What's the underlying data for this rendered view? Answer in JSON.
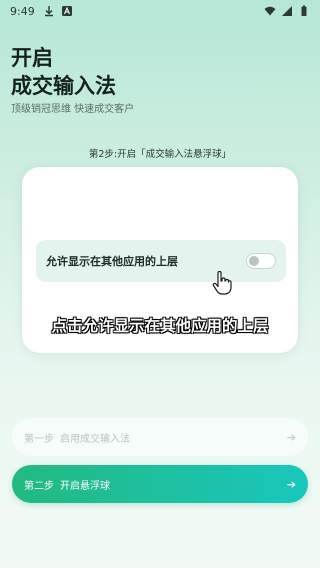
{
  "status_bar": {
    "time": "9:49",
    "icons": [
      "download-icon",
      "a-icon",
      "wifi-icon",
      "signal-icon",
      "battery-icon"
    ]
  },
  "header": {
    "title_line1": "开启",
    "title_line2": "成交输入法",
    "subtitle": "顶级销冠思维 快速成交客户"
  },
  "step_caption": "第2步:开启「成交输入法悬浮球」",
  "demo": {
    "toggle_label": "允许显示在其他应用的上层",
    "toggle_on": false,
    "overlay_text": "点击允许显示在其他应用的上层"
  },
  "steps": [
    {
      "step": "第一步",
      "label": "启用成交输入法",
      "enabled": false
    },
    {
      "step": "第二步",
      "label": "开启悬浮球",
      "enabled": true
    }
  ],
  "colors": {
    "accent_start": "#23b980",
    "accent_end": "#18c7bd",
    "background_top": "#b6e7d6"
  }
}
